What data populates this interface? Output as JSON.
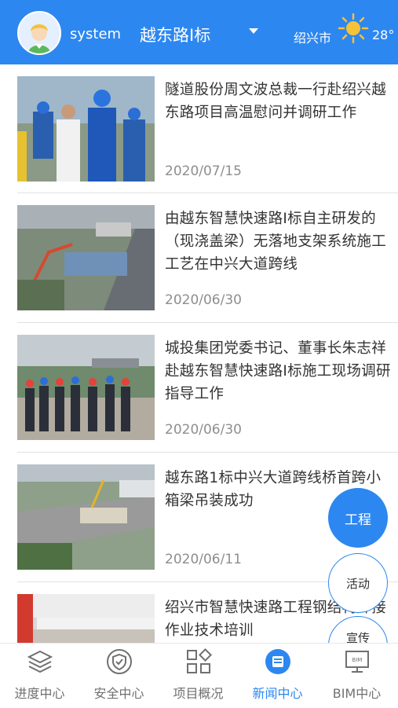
{
  "header": {
    "username": "system",
    "project": "越东路I标",
    "city": "绍兴市",
    "temperature": "28°",
    "weather_icon": "sun-icon",
    "accent": "#2d87f0"
  },
  "news": [
    {
      "title": "隧道股份周文波总裁一行赴绍兴越东路项目高温慰问并调研工作",
      "date": "2020/07/15"
    },
    {
      "title": "由越东智慧快速路I标自主研发的（现浇盖梁）无落地支架系统施工工艺在中兴大道跨线",
      "date": "2020/06/30"
    },
    {
      "title": "城投集团党委书记、董事长朱志祥赴越东智慧快速路I标施工现场调研指导工作",
      "date": "2020/06/30"
    },
    {
      "title": "越东路1标中兴大道跨线桥首跨小箱梁吊装成功",
      "date": "2020/06/11"
    },
    {
      "title": "绍兴市智慧快速路工程钢结构焊接作业技术培训",
      "date": ""
    }
  ],
  "fabs": {
    "engineering": "工程",
    "activity": "活动",
    "third": "宣传"
  },
  "tabs": [
    {
      "label": "进度中心",
      "icon": "layers-icon"
    },
    {
      "label": "安全中心",
      "icon": "shield-icon"
    },
    {
      "label": "项目概况",
      "icon": "grid-icon"
    },
    {
      "label": "新闻中心",
      "icon": "news-icon",
      "active": true
    },
    {
      "label": "BIM中心",
      "icon": "bim-monitor-icon"
    }
  ]
}
